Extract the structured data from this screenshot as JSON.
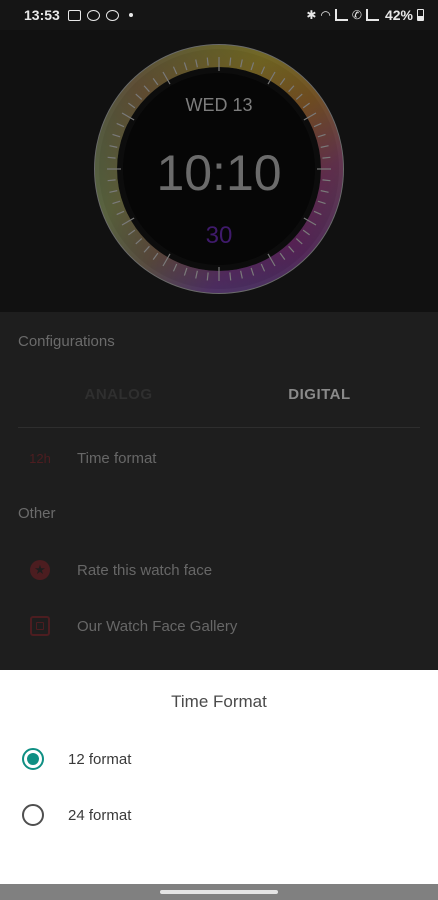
{
  "status_bar": {
    "time": "13:53",
    "battery": "42%"
  },
  "watch_face": {
    "date": "WED 13",
    "time": "10:10",
    "seconds": "30"
  },
  "config": {
    "header": "Configurations",
    "tabs": [
      {
        "label": "ANALOG",
        "active": false
      },
      {
        "label": "DIGITAL",
        "active": true
      }
    ],
    "time_format_icon": "12h",
    "time_format_label": "Time format"
  },
  "other": {
    "header": "Other",
    "items": [
      {
        "label": "Rate this watch face",
        "icon": "star-icon"
      },
      {
        "label": "Our Watch Face Gallery",
        "icon": "gallery-icon"
      }
    ]
  },
  "dialog": {
    "title": "Time Format",
    "options": [
      {
        "label": "12 format",
        "selected": true
      },
      {
        "label": "24 format",
        "selected": false
      }
    ]
  },
  "colors": {
    "accent": "#0f8f83",
    "icon_dim": "#4c1d20",
    "seconds": "#3f1a6b"
  }
}
